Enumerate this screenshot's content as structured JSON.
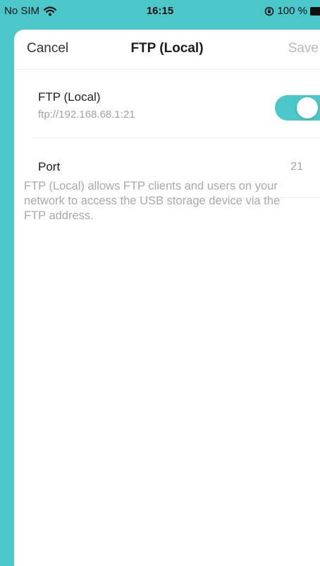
{
  "status_bar": {
    "carrier": "No SIM",
    "time": "16:15",
    "battery_text": "100 %",
    "icons": [
      "wifi-icon",
      "rotation-lock-icon",
      "battery-icon"
    ]
  },
  "nav": {
    "cancel_label": "Cancel",
    "title": "FTP (Local)",
    "save_label": "Save"
  },
  "ftp": {
    "label": "FTP (Local)",
    "address": "ftp://192.168.68.1:21",
    "enabled": true
  },
  "port": {
    "label": "Port",
    "value": "21"
  },
  "description": "FTP (Local) allows FTP clients and users on your network to access the USB storage device via the FTP address.",
  "colors": {
    "accent": "#4bc6c9",
    "muted_text": "#a3a3a3",
    "disabled_action": "#b9b9b9"
  }
}
